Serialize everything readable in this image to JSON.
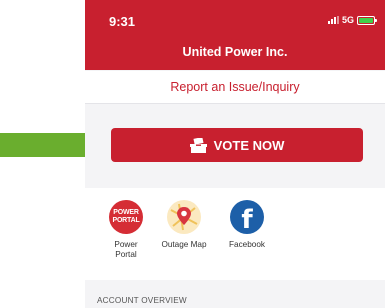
{
  "status": {
    "time": "9:31",
    "network": "5G"
  },
  "app": {
    "title": "United Power Inc."
  },
  "report_link": "Report an Issue/Inquiry",
  "vote_button": "VOTE NOW",
  "quick_links": [
    {
      "label_line1": "Power",
      "label_line2": "Portal",
      "logo_line1": "POWER",
      "logo_line2": "PORTAL"
    },
    {
      "label": "Outage Map"
    },
    {
      "label": "Facebook"
    }
  ],
  "section_title": "ACCOUNT OVERVIEW",
  "colors": {
    "brand_red": "#c8202f",
    "arrow_green": "#6aae2e",
    "facebook_blue": "#1d5fa8"
  }
}
